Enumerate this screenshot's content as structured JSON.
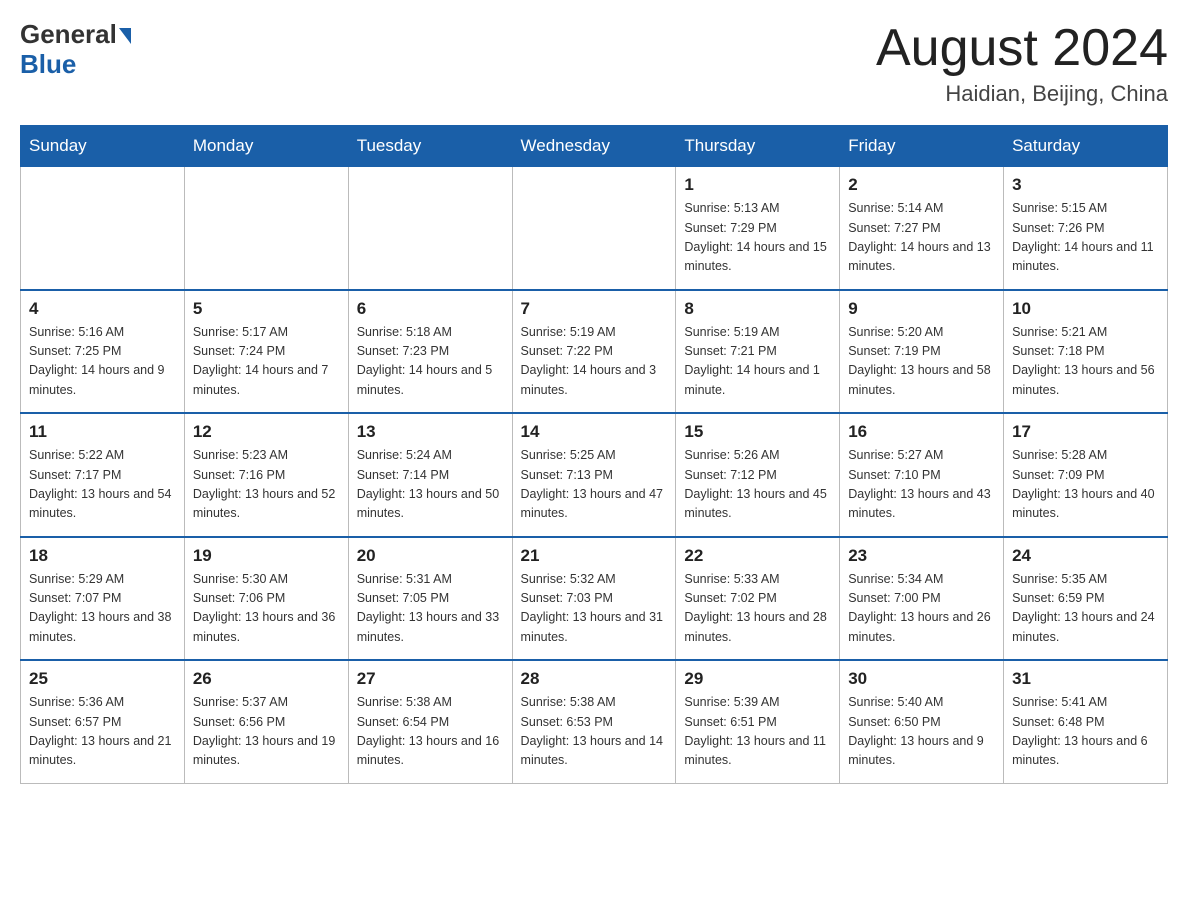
{
  "header": {
    "logo_general": "General",
    "logo_blue": "Blue",
    "month_title": "August 2024",
    "location": "Haidian, Beijing, China"
  },
  "days_of_week": [
    "Sunday",
    "Monday",
    "Tuesday",
    "Wednesday",
    "Thursday",
    "Friday",
    "Saturday"
  ],
  "weeks": [
    [
      {
        "day": "",
        "info": ""
      },
      {
        "day": "",
        "info": ""
      },
      {
        "day": "",
        "info": ""
      },
      {
        "day": "",
        "info": ""
      },
      {
        "day": "1",
        "info": "Sunrise: 5:13 AM\nSunset: 7:29 PM\nDaylight: 14 hours and 15 minutes."
      },
      {
        "day": "2",
        "info": "Sunrise: 5:14 AM\nSunset: 7:27 PM\nDaylight: 14 hours and 13 minutes."
      },
      {
        "day": "3",
        "info": "Sunrise: 5:15 AM\nSunset: 7:26 PM\nDaylight: 14 hours and 11 minutes."
      }
    ],
    [
      {
        "day": "4",
        "info": "Sunrise: 5:16 AM\nSunset: 7:25 PM\nDaylight: 14 hours and 9 minutes."
      },
      {
        "day": "5",
        "info": "Sunrise: 5:17 AM\nSunset: 7:24 PM\nDaylight: 14 hours and 7 minutes."
      },
      {
        "day": "6",
        "info": "Sunrise: 5:18 AM\nSunset: 7:23 PM\nDaylight: 14 hours and 5 minutes."
      },
      {
        "day": "7",
        "info": "Sunrise: 5:19 AM\nSunset: 7:22 PM\nDaylight: 14 hours and 3 minutes."
      },
      {
        "day": "8",
        "info": "Sunrise: 5:19 AM\nSunset: 7:21 PM\nDaylight: 14 hours and 1 minute."
      },
      {
        "day": "9",
        "info": "Sunrise: 5:20 AM\nSunset: 7:19 PM\nDaylight: 13 hours and 58 minutes."
      },
      {
        "day": "10",
        "info": "Sunrise: 5:21 AM\nSunset: 7:18 PM\nDaylight: 13 hours and 56 minutes."
      }
    ],
    [
      {
        "day": "11",
        "info": "Sunrise: 5:22 AM\nSunset: 7:17 PM\nDaylight: 13 hours and 54 minutes."
      },
      {
        "day": "12",
        "info": "Sunrise: 5:23 AM\nSunset: 7:16 PM\nDaylight: 13 hours and 52 minutes."
      },
      {
        "day": "13",
        "info": "Sunrise: 5:24 AM\nSunset: 7:14 PM\nDaylight: 13 hours and 50 minutes."
      },
      {
        "day": "14",
        "info": "Sunrise: 5:25 AM\nSunset: 7:13 PM\nDaylight: 13 hours and 47 minutes."
      },
      {
        "day": "15",
        "info": "Sunrise: 5:26 AM\nSunset: 7:12 PM\nDaylight: 13 hours and 45 minutes."
      },
      {
        "day": "16",
        "info": "Sunrise: 5:27 AM\nSunset: 7:10 PM\nDaylight: 13 hours and 43 minutes."
      },
      {
        "day": "17",
        "info": "Sunrise: 5:28 AM\nSunset: 7:09 PM\nDaylight: 13 hours and 40 minutes."
      }
    ],
    [
      {
        "day": "18",
        "info": "Sunrise: 5:29 AM\nSunset: 7:07 PM\nDaylight: 13 hours and 38 minutes."
      },
      {
        "day": "19",
        "info": "Sunrise: 5:30 AM\nSunset: 7:06 PM\nDaylight: 13 hours and 36 minutes."
      },
      {
        "day": "20",
        "info": "Sunrise: 5:31 AM\nSunset: 7:05 PM\nDaylight: 13 hours and 33 minutes."
      },
      {
        "day": "21",
        "info": "Sunrise: 5:32 AM\nSunset: 7:03 PM\nDaylight: 13 hours and 31 minutes."
      },
      {
        "day": "22",
        "info": "Sunrise: 5:33 AM\nSunset: 7:02 PM\nDaylight: 13 hours and 28 minutes."
      },
      {
        "day": "23",
        "info": "Sunrise: 5:34 AM\nSunset: 7:00 PM\nDaylight: 13 hours and 26 minutes."
      },
      {
        "day": "24",
        "info": "Sunrise: 5:35 AM\nSunset: 6:59 PM\nDaylight: 13 hours and 24 minutes."
      }
    ],
    [
      {
        "day": "25",
        "info": "Sunrise: 5:36 AM\nSunset: 6:57 PM\nDaylight: 13 hours and 21 minutes."
      },
      {
        "day": "26",
        "info": "Sunrise: 5:37 AM\nSunset: 6:56 PM\nDaylight: 13 hours and 19 minutes."
      },
      {
        "day": "27",
        "info": "Sunrise: 5:38 AM\nSunset: 6:54 PM\nDaylight: 13 hours and 16 minutes."
      },
      {
        "day": "28",
        "info": "Sunrise: 5:38 AM\nSunset: 6:53 PM\nDaylight: 13 hours and 14 minutes."
      },
      {
        "day": "29",
        "info": "Sunrise: 5:39 AM\nSunset: 6:51 PM\nDaylight: 13 hours and 11 minutes."
      },
      {
        "day": "30",
        "info": "Sunrise: 5:40 AM\nSunset: 6:50 PM\nDaylight: 13 hours and 9 minutes."
      },
      {
        "day": "31",
        "info": "Sunrise: 5:41 AM\nSunset: 6:48 PM\nDaylight: 13 hours and 6 minutes."
      }
    ]
  ]
}
